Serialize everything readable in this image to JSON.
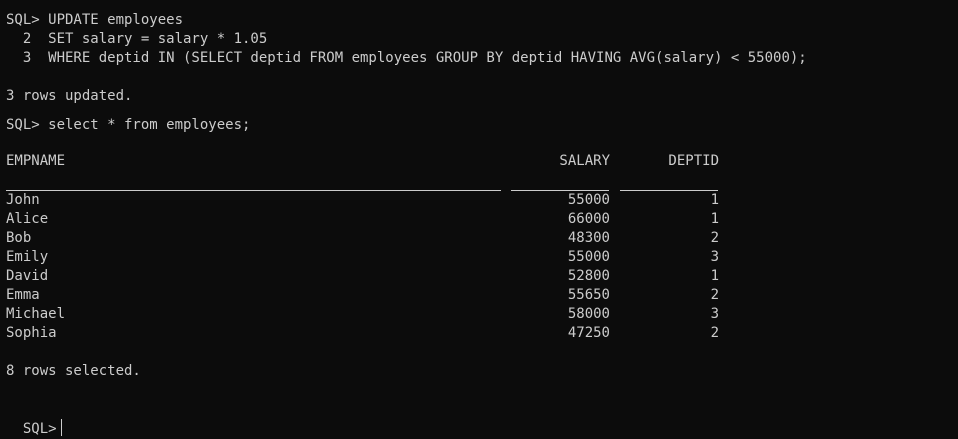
{
  "session": {
    "prompt_1": "SQL> UPDATE employees",
    "line_2": "  2  SET salary = salary * 1.05",
    "line_3": "  3  WHERE deptid IN (SELECT deptid FROM employees GROUP BY deptid HAVING AVG(salary) < 55000);",
    "update_feedback": "3 rows updated.",
    "prompt_2": "SQL> select * from employees;",
    "select_feedback": "8 rows selected.",
    "prompt_3": "SQL>"
  },
  "table": {
    "headers": [
      "EMPNAME",
      "SALARY",
      "DEPTID"
    ],
    "rows": [
      [
        "John",
        "55000",
        "1"
      ],
      [
        "Alice",
        "66000",
        "1"
      ],
      [
        "Bob",
        "48300",
        "2"
      ],
      [
        "Emily",
        "55000",
        "3"
      ],
      [
        "David",
        "52800",
        "1"
      ],
      [
        "Emma",
        "55650",
        "2"
      ],
      [
        "Michael",
        "58000",
        "3"
      ],
      [
        "Sophia",
        "47250",
        "2"
      ]
    ]
  },
  "colors": {
    "background": "#0c0c0c",
    "text": "#cccccc"
  }
}
